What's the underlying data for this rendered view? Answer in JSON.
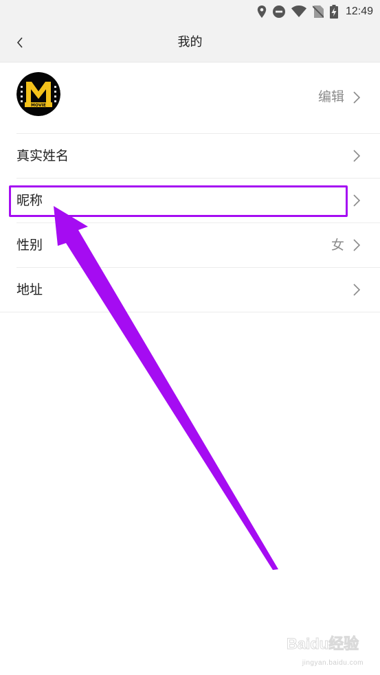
{
  "status_bar": {
    "time": "12:49",
    "icons": [
      "location-icon",
      "do-not-disturb-icon",
      "wifi-icon",
      "no-sim-icon",
      "battery-charging-icon"
    ]
  },
  "header": {
    "title": "我的",
    "back_icon": "chevron-left-icon"
  },
  "profile": {
    "avatar_logo": "MOVIE",
    "edit_label": "编辑"
  },
  "rows": [
    {
      "label": "真实姓名",
      "value": ""
    },
    {
      "label": "昵称",
      "value": ""
    },
    {
      "label": "性别",
      "value": "女"
    },
    {
      "label": "地址",
      "value": ""
    }
  ],
  "annotation": {
    "color": "#a50cf2",
    "highlighted_row": "昵称"
  },
  "watermark": {
    "logo": "Baidu经验",
    "caption": "jingyan.baidu.com"
  },
  "colors": {
    "header_bg": "#f2f2f2",
    "text_primary": "#222222",
    "text_secondary": "#8a8a8a",
    "divider": "#ececec",
    "avatar_gold": "#f4c21b"
  }
}
